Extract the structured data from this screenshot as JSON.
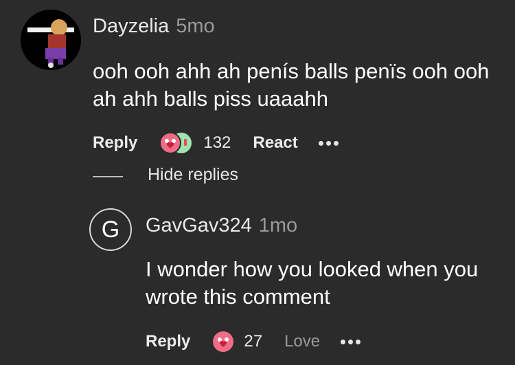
{
  "comment": {
    "username": "Dayzelia",
    "time": "5mo",
    "text": "ooh ooh ahh ah penís balls penïs ooh ooh ah ahh balls piss uaaahh",
    "reply_label": "Reply",
    "reaction_count": "132",
    "react_label": "React",
    "hide_replies_label": "Hide replies"
  },
  "reply": {
    "avatar_letter": "G",
    "username": "GavGav324",
    "time": "1mo",
    "text": "I wonder how you looked when you wrote this comment",
    "reply_label": "Reply",
    "reaction_count": "27",
    "love_label": "Love"
  },
  "colors": {
    "background": "#2b2b2c",
    "love_reaction": "#f06d86",
    "laugh_reaction": "#9fe3b0"
  }
}
